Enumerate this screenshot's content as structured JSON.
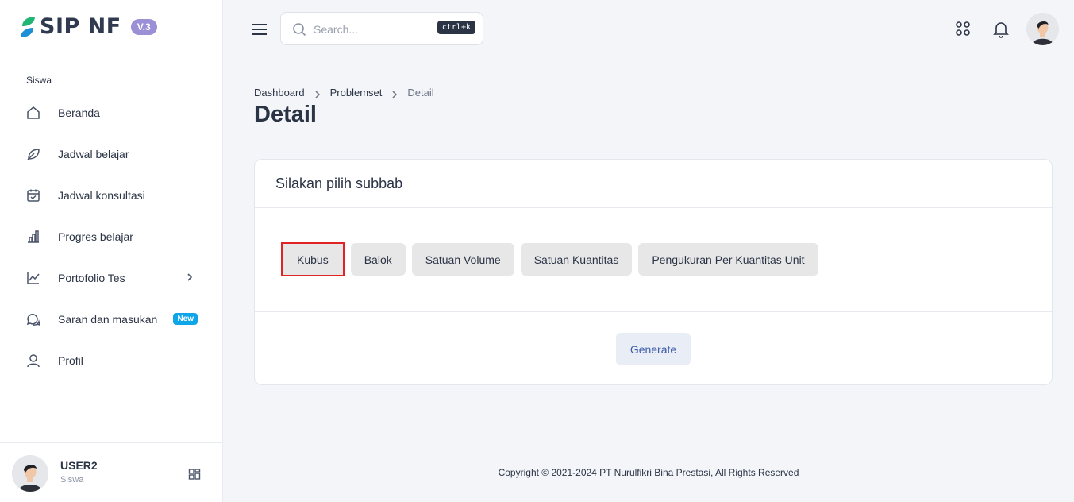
{
  "app": {
    "name": "SIP NF",
    "version": "V.3",
    "brand_color": "#2f3a4f",
    "accent_color": "#9b8fd6"
  },
  "sidebar": {
    "section_label": "Siswa",
    "items": [
      {
        "label": "Beranda",
        "icon": "home-icon"
      },
      {
        "label": "Jadwal belajar",
        "icon": "leaf-icon"
      },
      {
        "label": "Jadwal konsultasi",
        "icon": "calendar-check-icon"
      },
      {
        "label": "Progres belajar",
        "icon": "bar-chart-icon"
      },
      {
        "label": "Portofolio Tes",
        "icon": "line-chart-icon",
        "has_submenu": true
      },
      {
        "label": "Saran dan masukan",
        "icon": "chat-icon",
        "badge": "New"
      },
      {
        "label": "Profil",
        "icon": "user-icon"
      }
    ],
    "user": {
      "name": "USER2",
      "role": "Siswa"
    }
  },
  "header": {
    "search": {
      "placeholder": "Search...",
      "shortcut": "ctrl+k"
    }
  },
  "breadcrumb": [
    "Dashboard",
    "Problemset",
    "Detail"
  ],
  "page_title": "Detail",
  "card": {
    "title": "Silakan pilih subbab",
    "options": [
      "Kubus",
      "Balok",
      "Satuan Volume",
      "Satuan Kuantitas",
      "Pengukuran Per Kuantitas Unit"
    ],
    "selected": "Kubus",
    "generate_label": "Generate"
  },
  "footer": {
    "copyright": "Copyright © 2021-2024 PT Nurulfikri Bina Prestasi, All Rights Reserved"
  }
}
